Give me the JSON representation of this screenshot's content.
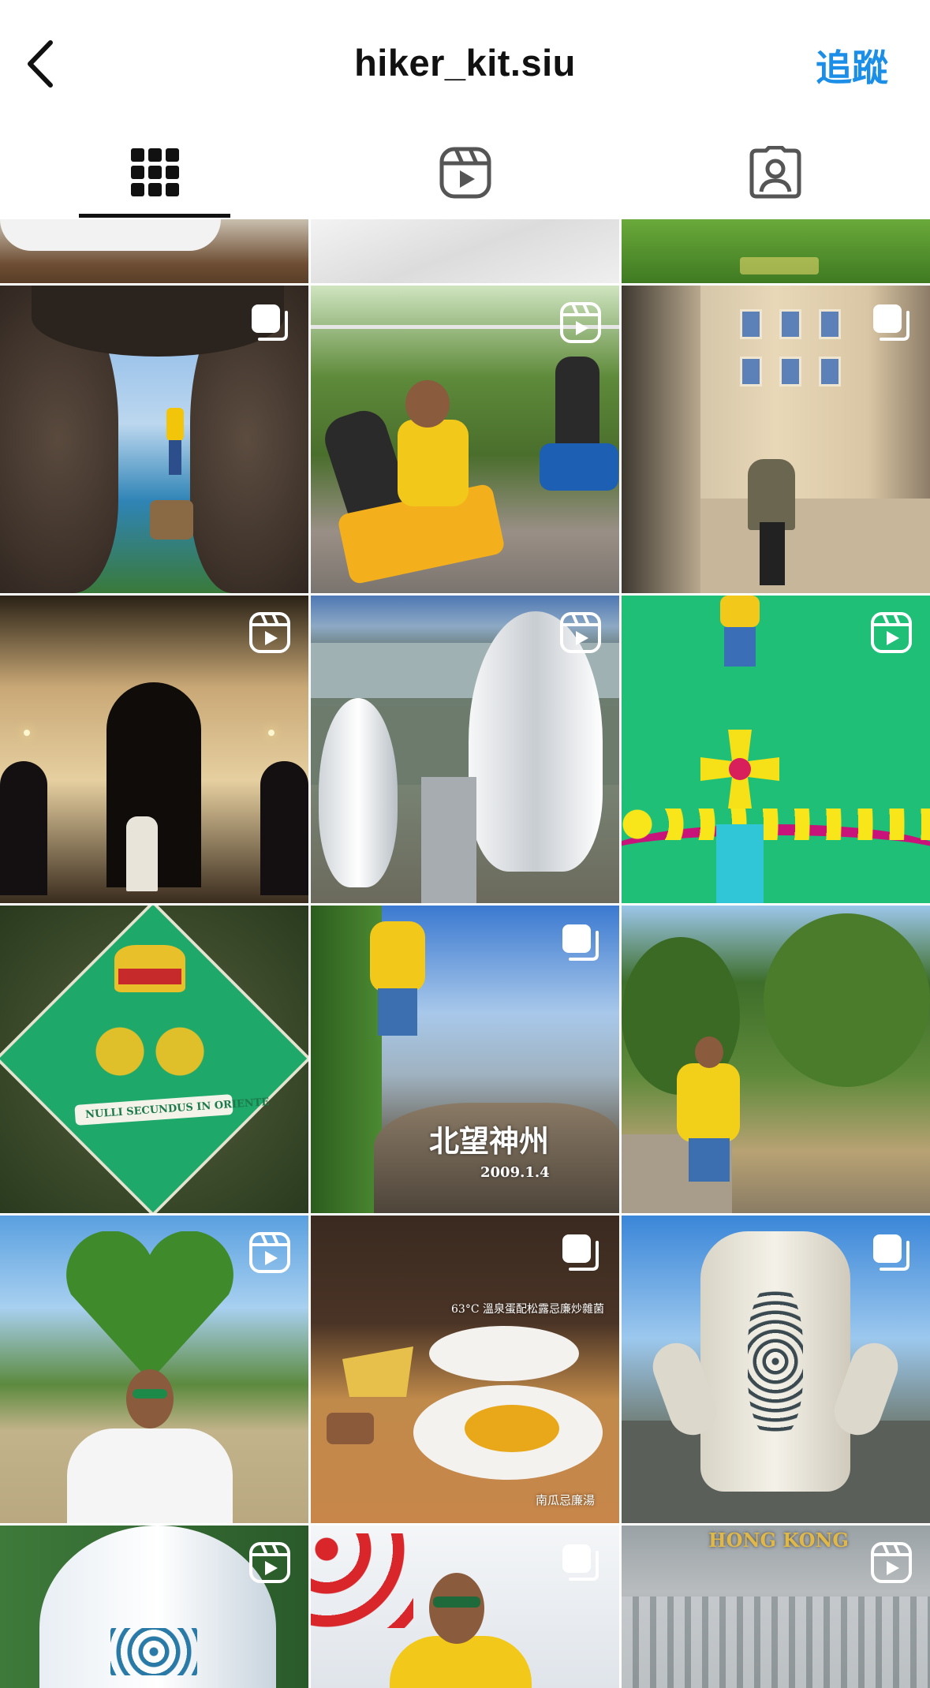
{
  "header": {
    "username": "hiker_kit.siu",
    "follow_label": "追蹤"
  },
  "tabs": [
    {
      "name": "grid-icon",
      "active": true
    },
    {
      "name": "reels-icon",
      "active": false
    },
    {
      "name": "tagged-icon",
      "active": false
    }
  ],
  "colors": {
    "accent": "#1b8ee8",
    "text": "#111111",
    "icon_gray": "#555555"
  },
  "posts": [
    {
      "type": "carousel",
      "subject": "rock window with hiker in yellow jacket over sea"
    },
    {
      "type": "reel",
      "subject": "man in yellow jacket on mountain coaster"
    },
    {
      "type": "carousel",
      "subject": "man in puffer jacket at ornate palace facade at night"
    },
    {
      "type": "reel",
      "subject": "illuminated gothic arch building at night"
    },
    {
      "type": "reel",
      "subject": "aerial view of white shell-shaped buildings by the sea"
    },
    {
      "type": "reel",
      "subject": "man lying above green crest painting"
    },
    {
      "type": "none",
      "subject": "aerial view of green crest with crown and dragons"
    },
    {
      "type": "carousel",
      "subject": "man in yellow jacket standing on inscribed rock"
    },
    {
      "type": "none",
      "subject": "hiker in yellow jacket on trail among trees"
    },
    {
      "type": "reel",
      "subject": "heart-shaped tree with man making heart gesture"
    },
    {
      "type": "carousel",
      "subject": "plated dishes with fries and soup"
    },
    {
      "type": "carousel",
      "subject": "white sculptural building with perforated pattern"
    },
    {
      "type": "reel",
      "subject": "aerial view of white egg-shaped building"
    },
    {
      "type": "carousel",
      "subject": "man in yellow jacket with red lanterns"
    },
    {
      "type": "reel",
      "subject": "aerial view of Hong Kong skyline"
    }
  ],
  "captions": {
    "rock_line1": "北望神州",
    "rock_line2": "2009.1.4",
    "food_top": "63°C 溫泉蛋配松露忌廉炒雜菌",
    "food_bottom": "南瓜忌廉湯",
    "hk_title": "HONG KONG",
    "crest_motto": "NULLI SECUNDUS IN ORIENTE"
  }
}
